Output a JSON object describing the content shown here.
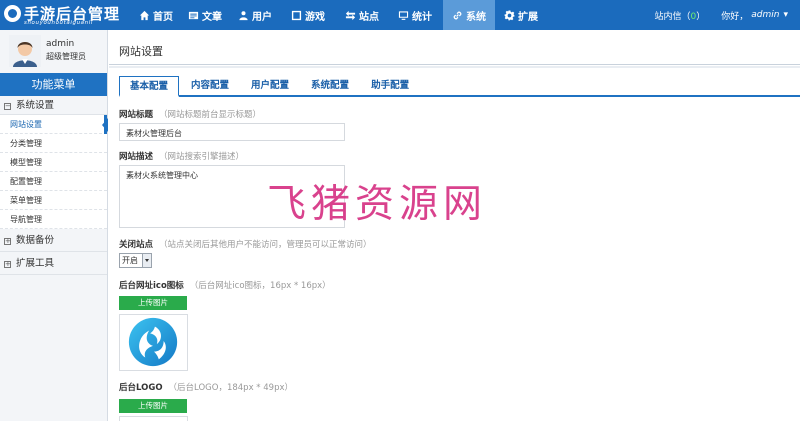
{
  "app": {
    "logo_title": "手游后台管理",
    "logo_subtitle": "shouyouhoutaiguanli"
  },
  "nav": {
    "items": [
      {
        "label": "首页",
        "icon": "home-icon"
      },
      {
        "label": "文章",
        "icon": "article-icon"
      },
      {
        "label": "用户",
        "icon": "user-icon"
      },
      {
        "label": "游戏",
        "icon": "game-icon"
      },
      {
        "label": "站点",
        "icon": "site-icon"
      },
      {
        "label": "统计",
        "icon": "monitor-icon"
      },
      {
        "label": "系统",
        "icon": "link-icon",
        "active": true
      },
      {
        "label": "扩展",
        "icon": "gear-icon"
      }
    ]
  },
  "top_right": {
    "messages_label": "站内信（",
    "messages_count": "0",
    "messages_close": "）",
    "greeting": "你好，",
    "username": "admin"
  },
  "sidebar": {
    "profile_name": "admin",
    "profile_role": "超级管理员",
    "menu_title": "功能菜单",
    "groups": [
      {
        "label": "系统设置",
        "toggle": "−",
        "items": [
          "网站设置",
          "分类管理",
          "模型管理",
          "配置管理",
          "菜单管理",
          "导航管理"
        ]
      },
      {
        "label": "数据备份",
        "toggle": "+"
      },
      {
        "label": "扩展工具",
        "toggle": "+"
      }
    ]
  },
  "main": {
    "page_title": "网站设置",
    "tabs": [
      "基本配置",
      "内容配置",
      "用户配置",
      "系统配置",
      "助手配置"
    ],
    "fields": {
      "site_title": {
        "label": "网站标题",
        "hint": "（网站标题前台显示标题）",
        "value": "素材火管理后台"
      },
      "site_desc": {
        "label": "网站描述",
        "hint": "（网站搜索引擎描述）",
        "value": "素材火系统管理中心"
      },
      "close_site": {
        "label": "关闭站点",
        "hint": "（站点关闭后其他用户不能访问，管理员可以正常访问）",
        "value": "开启"
      },
      "favicon": {
        "label": "后台网址ico图标",
        "hint": "（后台网址ico图标，16px * 16px）",
        "button": "上传图片"
      },
      "logo": {
        "label": "后台LOGO",
        "hint": "（后台LOGO，184px * 49px）",
        "button": "上传图片"
      }
    }
  },
  "watermark": "飞猪资源网",
  "colors": {
    "topbar": "#1b6bbd",
    "active_nav": "#5b9bd9",
    "upload_button": "#2aab4b",
    "watermark": "#d63384"
  }
}
